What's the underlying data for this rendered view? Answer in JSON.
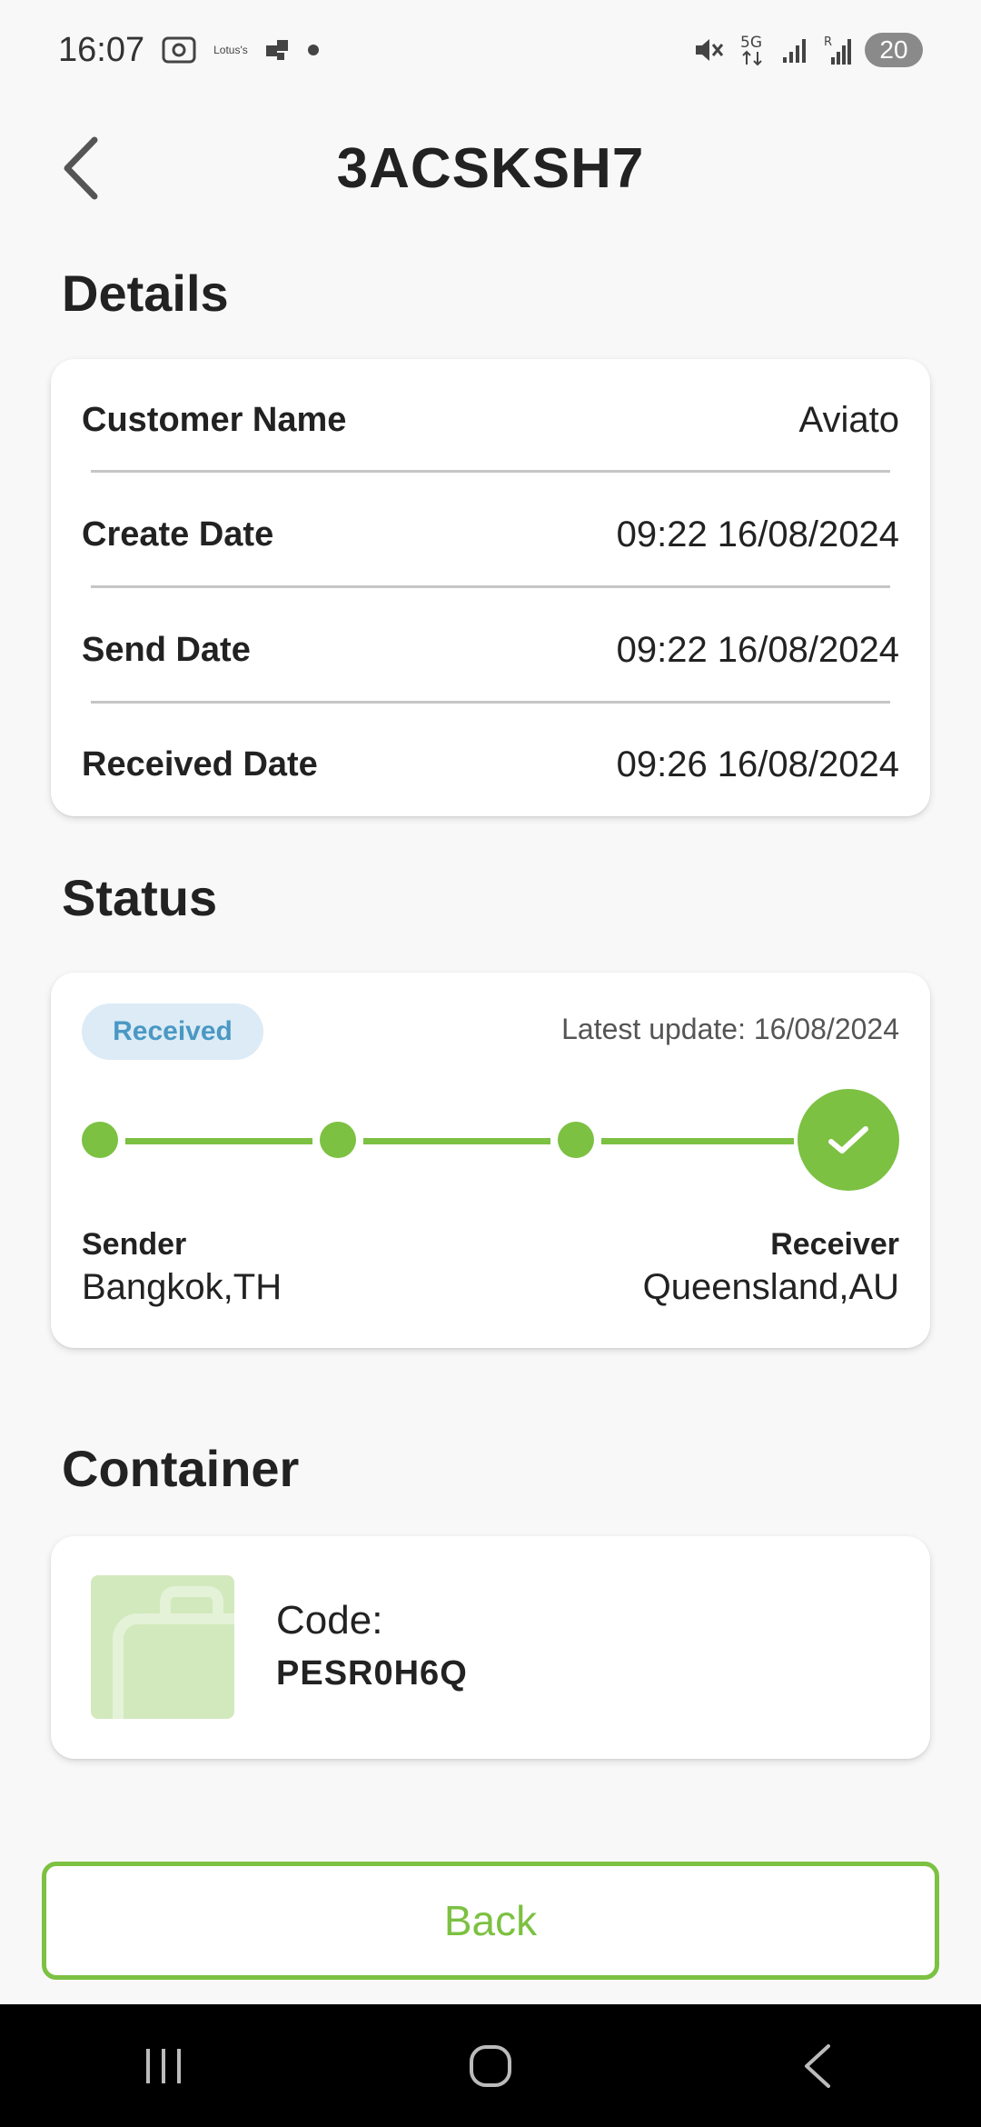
{
  "status_bar": {
    "time": "16:07",
    "carrier_app": "Lotus's",
    "battery": "20",
    "network": "5G"
  },
  "header": {
    "title": "3ACSKSH7"
  },
  "details": {
    "section_title": "Details",
    "rows": [
      {
        "label": "Customer Name",
        "value": "Aviato"
      },
      {
        "label": "Create Date",
        "value": "09:22 16/08/2024"
      },
      {
        "label": "Send Date",
        "value": "09:22 16/08/2024"
      },
      {
        "label": "Received Date",
        "value": "09:26 16/08/2024"
      }
    ]
  },
  "status": {
    "section_title": "Status",
    "badge": "Received",
    "latest_update": "Latest update: 16/08/2024",
    "progress_steps_total": 4,
    "progress_steps_completed": 4,
    "sender_label": "Sender",
    "sender_location": "Bangkok,TH",
    "receiver_label": "Receiver",
    "receiver_location": "Queensland,AU"
  },
  "container": {
    "section_title": "Container",
    "code_label": "Code:",
    "code_value": "PESR0H6Q",
    "icon": "briefcase-icon"
  },
  "actions": {
    "back_label": "Back"
  },
  "colors": {
    "accent_green": "#7cc142",
    "badge_bg": "#dcebf5",
    "badge_text": "#4a98c4",
    "background": "#f8f8f8"
  }
}
